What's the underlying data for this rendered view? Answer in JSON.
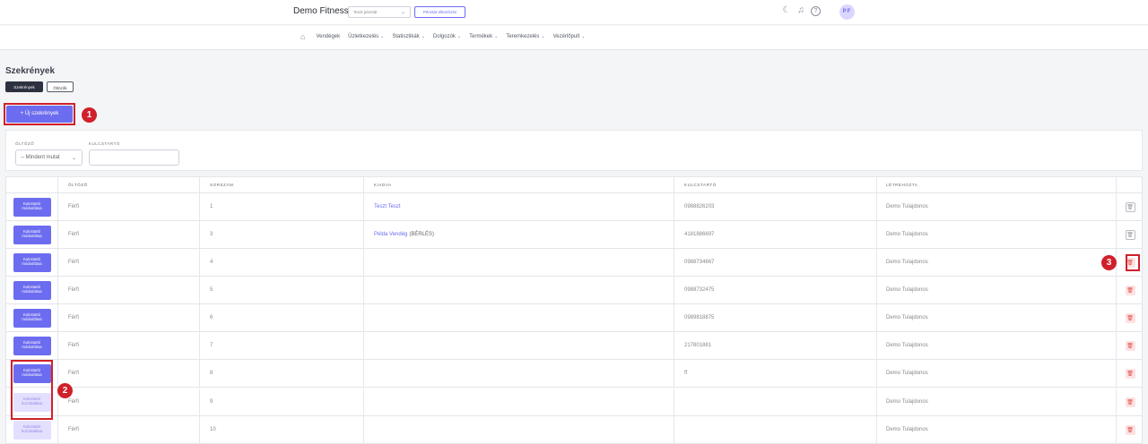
{
  "header": {
    "brand": "Demo Fitness",
    "register_select": "Teszt pénztár",
    "register_check_button": "Pénztár ellenőrzés",
    "avatar_initials": "PF"
  },
  "nav": {
    "items": [
      {
        "label": "Vendégek",
        "caret": false
      },
      {
        "label": "Üzletkezelés",
        "caret": true
      },
      {
        "label": "Statisztikák",
        "caret": true
      },
      {
        "label": "Dolgozók",
        "caret": true
      },
      {
        "label": "Termékek",
        "caret": true
      },
      {
        "label": "Teremkezelés",
        "caret": true
      },
      {
        "label": "Vezérlőpult",
        "caret": true
      }
    ]
  },
  "page": {
    "title": "Szekrények",
    "tabs": [
      "Szekrények",
      "Öltözők"
    ],
    "new_button": "+ Új szekrények"
  },
  "filters": {
    "oltozo_label": "ÖLTÖZŐ",
    "oltozo_value": "-- Mindent mutat",
    "kulcstarto_label": "KULCSTARTÓ",
    "kulcstarto_value": ""
  },
  "table": {
    "columns": [
      "",
      "ÖLTÖZŐ",
      "SORSZÁM",
      "KIADVA",
      "KULCSTARTÓ",
      "LÉTREHOZTA",
      ""
    ],
    "rows": [
      {
        "action": "Kulcstartó módosítása",
        "action_type": "primary",
        "oltozo": "Férfi",
        "sorszam": "1",
        "kiadva": "Teszt Teszt",
        "kiadva_suffix": "",
        "kulcstarto": "0988826203",
        "letrehozta": "Demo Tulajdonos",
        "delete_style": "disabled"
      },
      {
        "action": "Kulcstartó módosítása",
        "action_type": "primary",
        "oltozo": "Férfi",
        "sorszam": "3",
        "kiadva": "Példa Vendég",
        "kiadva_suffix": "(BÉRLÉS)",
        "kulcstarto": "4181886697",
        "letrehozta": "Demo Tulajdonos",
        "delete_style": "disabled"
      },
      {
        "action": "Kulcstartó módosítása",
        "action_type": "primary",
        "oltozo": "Férfi",
        "sorszam": "4",
        "kiadva": "",
        "kiadva_suffix": "",
        "kulcstarto": "0988734667",
        "letrehozta": "Demo Tulajdonos",
        "delete_style": "danger"
      },
      {
        "action": "Kulcstartó módosítása",
        "action_type": "primary",
        "oltozo": "Férfi",
        "sorszam": "5",
        "kiadva": "",
        "kiadva_suffix": "",
        "kulcstarto": "0988732475",
        "letrehozta": "Demo Tulajdonos",
        "delete_style": "danger"
      },
      {
        "action": "Kulcstartó módosítása",
        "action_type": "primary",
        "oltozo": "Férfi",
        "sorszam": "6",
        "kiadva": "",
        "kiadva_suffix": "",
        "kulcstarto": "0989818875",
        "letrehozta": "Demo Tulajdonos",
        "delete_style": "danger"
      },
      {
        "action": "Kulcstartó módosítása",
        "action_type": "primary",
        "oltozo": "Férfi",
        "sorszam": "7",
        "kiadva": "",
        "kiadva_suffix": "",
        "kulcstarto": "217801881",
        "letrehozta": "Demo Tulajdonos",
        "delete_style": "danger"
      },
      {
        "action": "Kulcstartó módosítása",
        "action_type": "primary",
        "oltozo": "Férfi",
        "sorszam": "8",
        "kiadva": "",
        "kiadva_suffix": "",
        "kulcstarto": "ff",
        "letrehozta": "Demo Tulajdonos",
        "delete_style": "danger"
      },
      {
        "action": "Kulcstartó hozzáadása",
        "action_type": "light",
        "oltozo": "Férfi",
        "sorszam": "9",
        "kiadva": "",
        "kiadva_suffix": "",
        "kulcstarto": "",
        "letrehozta": "Demo Tulajdonos",
        "delete_style": "danger"
      },
      {
        "action": "Kulcstartó hozzáadása",
        "action_type": "light",
        "oltozo": "Férfi",
        "sorszam": "10",
        "kiadva": "",
        "kiadva_suffix": "",
        "kulcstarto": "",
        "letrehozta": "Demo Tulajdonos",
        "delete_style": "danger"
      }
    ]
  },
  "callouts": [
    "1",
    "2",
    "3"
  ],
  "colors": {
    "accent": "#6c6cf0",
    "highlight": "#d0202a",
    "danger": "#e05050"
  }
}
